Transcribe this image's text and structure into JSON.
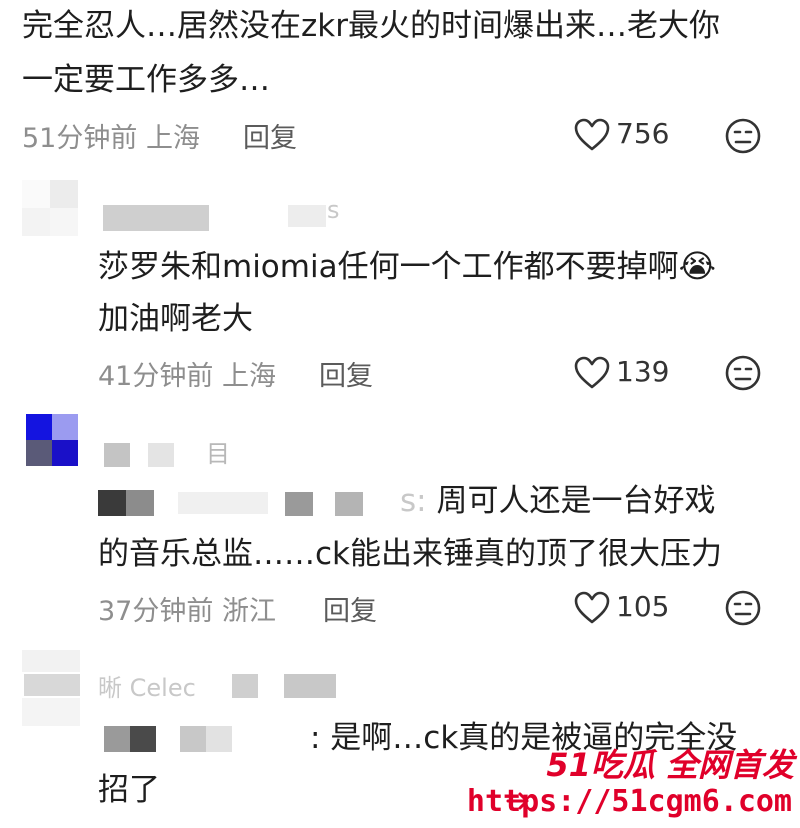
{
  "comments": [
    {
      "text_lines": [
        "完全忍人…居然没在zkr最火的时间爆出来…老大你",
        "一定要工作多多…"
      ],
      "time": "51分钟前",
      "location": "上海",
      "reply_label": "回复",
      "likes": "756"
    },
    {
      "username_partial": "s",
      "text_lines": [
        "莎罗朱和miomia任何一个工作都不要掉啊",
        "加油啊老大"
      ],
      "emoji": "😭",
      "time": "41分钟前",
      "location": "上海",
      "reply_label": "回复",
      "likes": "139"
    },
    {
      "username_partial": "目",
      "reply_prefix": "s:",
      "text_lines": [
        "周可人还是一台好戏",
        "的音乐总监……ck能出来锤真的顶了很大压力"
      ],
      "time": "37分钟前",
      "location": "浙江",
      "reply_label": "回复",
      "likes": "105"
    },
    {
      "username_partial": "晰 Celec",
      "text_lines": [
        ": 是啊…ck真的是被逼的完全没",
        "招了"
      ]
    }
  ],
  "watermark": {
    "brand": "51吃瓜 全网首发",
    "url": "https://51cgm6.com"
  },
  "icons": [
    "heart-icon",
    "dislike-face-icon"
  ]
}
